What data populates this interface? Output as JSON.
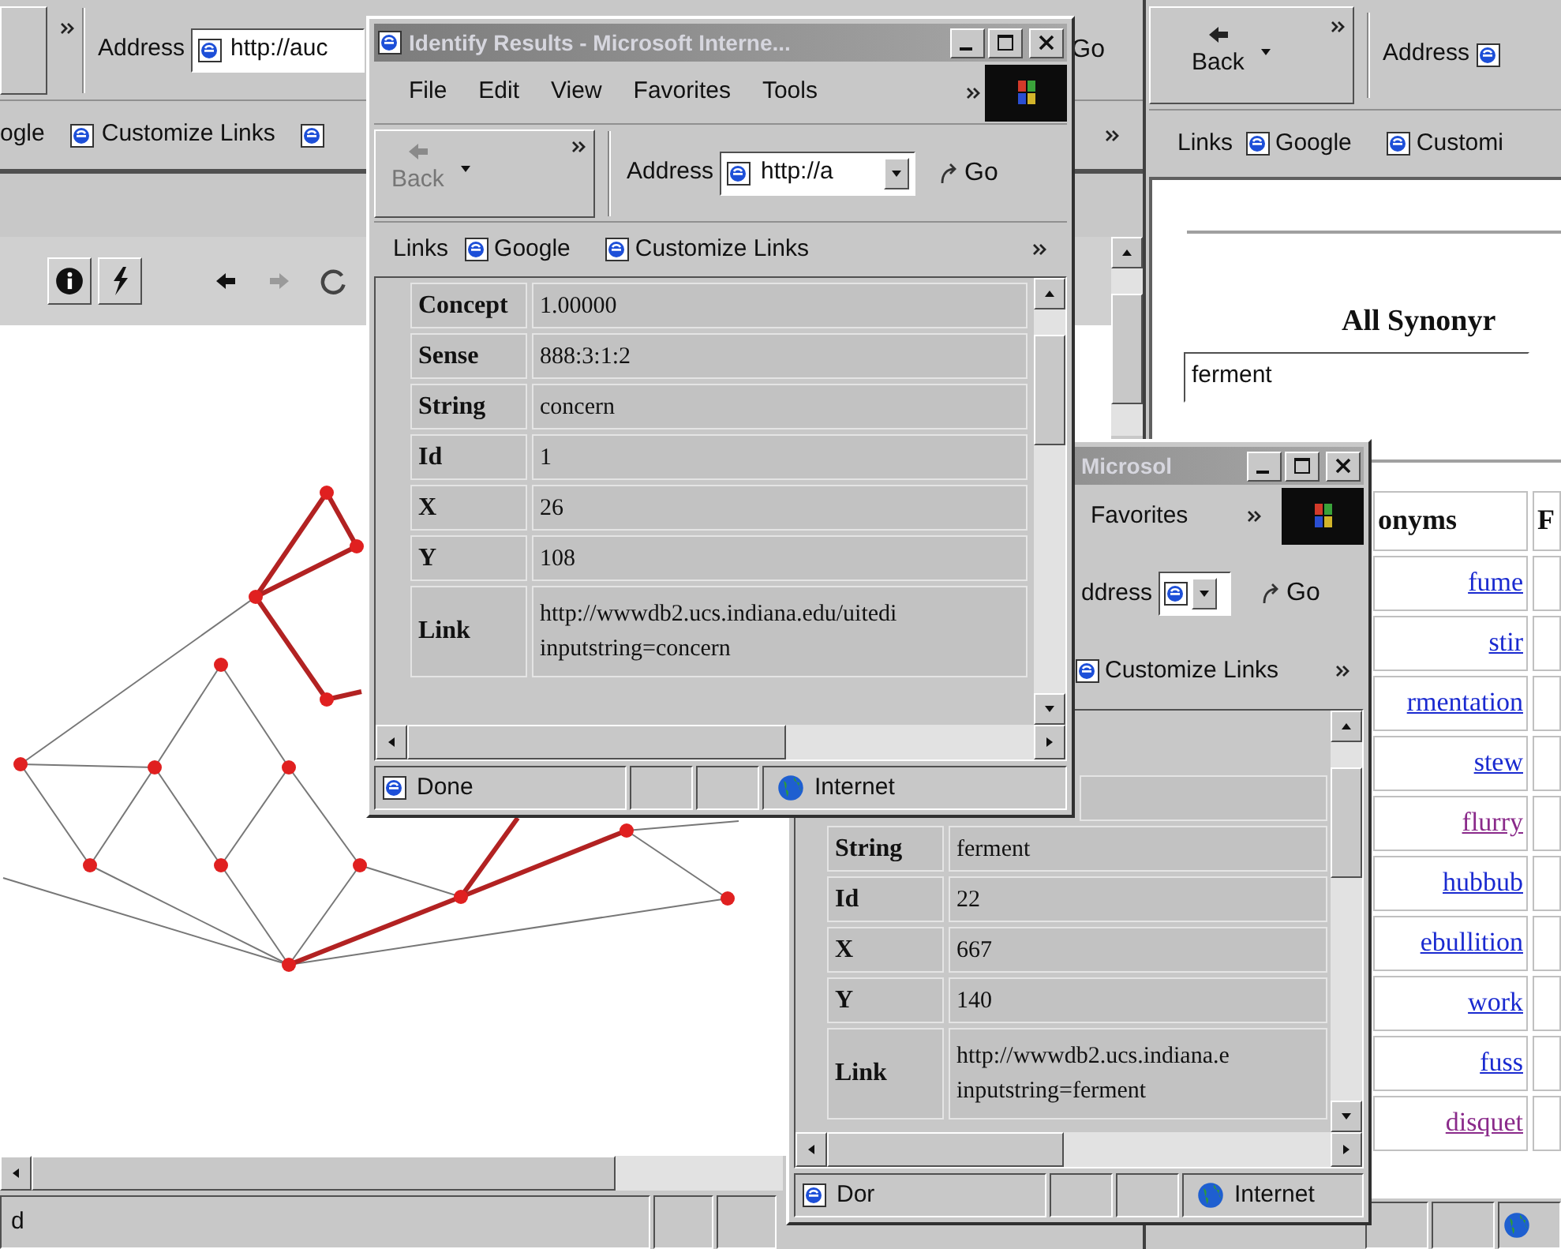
{
  "left_browser": {
    "address": {
      "label": "Address",
      "value": "http://auc"
    },
    "go_label": "Go",
    "links": [
      "ogle",
      "Customize Links"
    ],
    "status": "d"
  },
  "right_browser": {
    "back": {
      "label": "Back",
      "disabled": false
    },
    "address_label": "Address",
    "links_label": "Links",
    "links": [
      "Google",
      "Customi"
    ],
    "heading": "All Synonyr",
    "search_value": "ferment",
    "columns": [
      "onyms",
      "F"
    ],
    "synonyms": [
      {
        "text": "fume",
        "visited": false
      },
      {
        "text": "stir",
        "visited": false
      },
      {
        "text": "rmentation",
        "visited": false
      },
      {
        "text": "stew",
        "visited": false
      },
      {
        "text": "flurry",
        "visited": true
      },
      {
        "text": "hubbub",
        "visited": false
      },
      {
        "text": "ebullition",
        "visited": false
      },
      {
        "text": "work",
        "visited": false
      },
      {
        "text": "fuss",
        "visited": false
      },
      {
        "text": "disquet",
        "visited": true
      }
    ]
  },
  "results_window": {
    "title": "Identify Results - Microsoft Interne...",
    "menu": [
      "File",
      "Edit",
      "View",
      "Favorites",
      "Tools"
    ],
    "back": {
      "label": "Back",
      "disabled": true
    },
    "address": {
      "label": "Address",
      "value": "http://a"
    },
    "go_label": "Go",
    "links_label": "Links",
    "links": [
      "Google",
      "Customize Links"
    ],
    "rows": [
      {
        "label": "Concept",
        "value": "1.00000"
      },
      {
        "label": "Sense",
        "value": "888:3:1:2"
      },
      {
        "label": "String",
        "value": "concern"
      },
      {
        "label": "Id",
        "value": "1"
      },
      {
        "label": "X",
        "value": "26"
      },
      {
        "label": "Y",
        "value": "108"
      },
      {
        "label": "Link",
        "lines": [
          "http://wwwdb2.ucs.indiana.edu/uitedi",
          "inputstring=concern"
        ]
      }
    ],
    "status": "Done",
    "zone": "Internet"
  },
  "second_window": {
    "title": "Microsol",
    "menu": [
      "Favorites"
    ],
    "address_label": "ddress",
    "go_label": "Go",
    "links": [
      "Customize Links"
    ],
    "rows": [
      {
        "label": "String",
        "value": "ferment"
      },
      {
        "label": "Id",
        "value": "22"
      },
      {
        "label": "X",
        "value": "667"
      },
      {
        "label": "Y",
        "value": "140"
      },
      {
        "label": "Link",
        "lines": [
          "http://wwwdb2.ucs.indiana.e",
          "inputstring=ferment"
        ]
      }
    ],
    "status": "Dor",
    "zone": "Internet"
  }
}
